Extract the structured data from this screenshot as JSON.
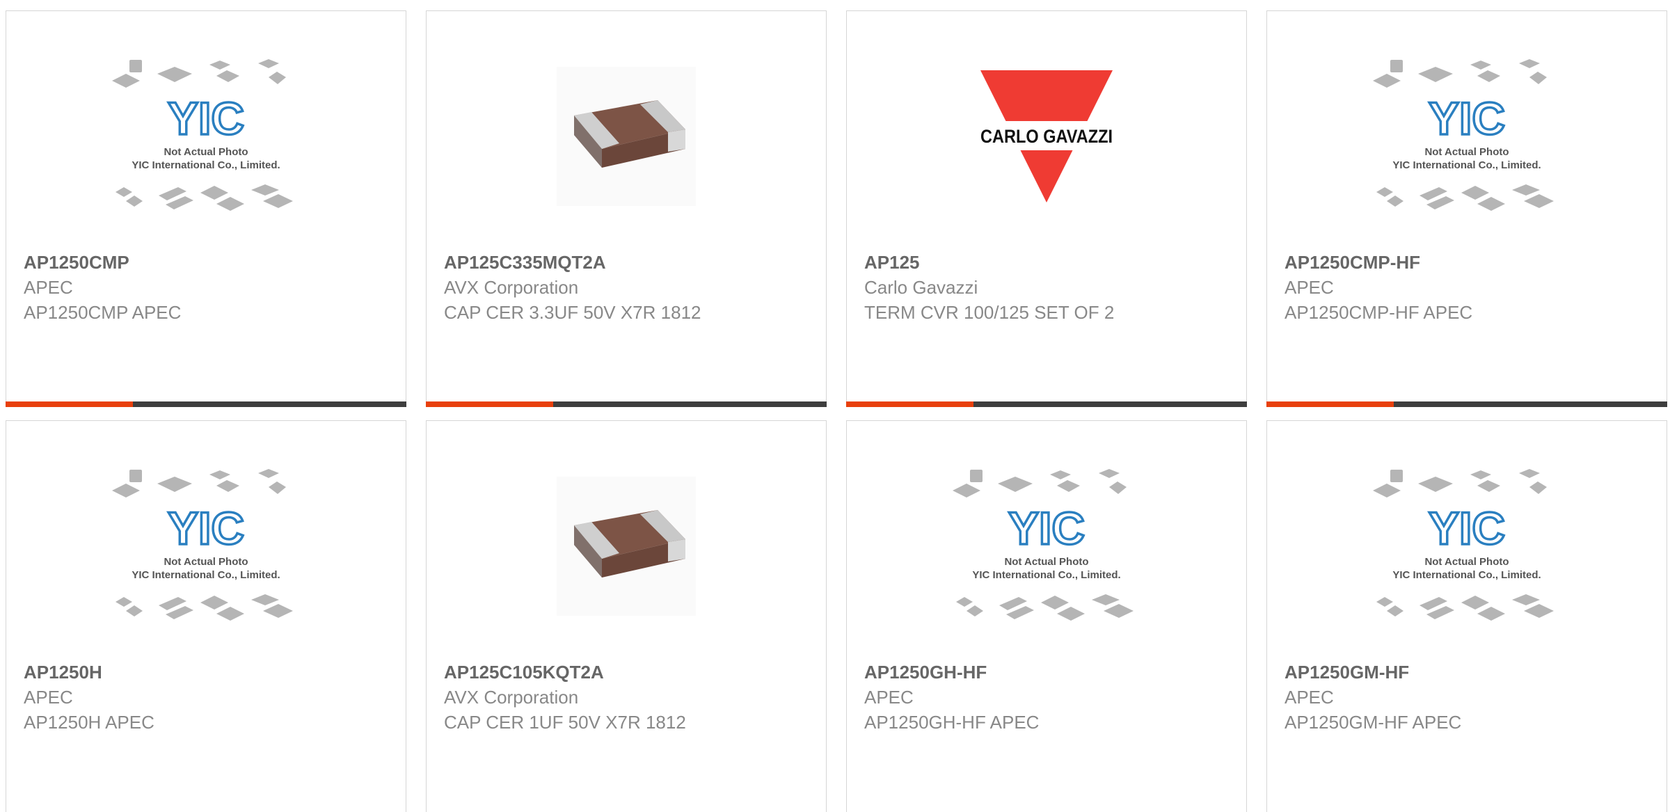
{
  "colors": {
    "accent": "#e8400c",
    "bar_dark": "#3e3e3e",
    "part_text": "#666666",
    "secondary_text": "#888888",
    "yic_blue": "#2a7fc0",
    "gavazzi_red": "#ef3b33"
  },
  "placeholder_image": {
    "line1": "Not Actual Photo",
    "line2": "YIC International Co., Limited.",
    "logo": "YIC"
  },
  "brand_logo": {
    "text": "CARLO GAVAZZI"
  },
  "products": [
    {
      "part": "AP1250CMP",
      "manufacturer": "APEC",
      "description": "AP1250CMP APEC",
      "image": "yic-placeholder-icon"
    },
    {
      "part": "AP125C335MQT2A",
      "manufacturer": "AVX Corporation",
      "description": "CAP CER 3.3UF 50V X7R 1812",
      "image": "ceramic-capacitor-icon"
    },
    {
      "part": "AP125",
      "manufacturer": "Carlo Gavazzi",
      "description": "TERM CVR 100/125 SET OF 2",
      "image": "carlo-gavazzi-logo-icon"
    },
    {
      "part": "AP1250CMP-HF",
      "manufacturer": "APEC",
      "description": "AP1250CMP-HF APEC",
      "image": "yic-placeholder-icon"
    },
    {
      "part": "AP1250H",
      "manufacturer": "APEC",
      "description": "AP1250H APEC",
      "image": "yic-placeholder-icon"
    },
    {
      "part": "AP125C105KQT2A",
      "manufacturer": "AVX Corporation",
      "description": "CAP CER 1UF 50V X7R 1812",
      "image": "ceramic-capacitor-icon"
    },
    {
      "part": "AP1250GH-HF",
      "manufacturer": "APEC",
      "description": "AP1250GH-HF APEC",
      "image": "yic-placeholder-icon"
    },
    {
      "part": "AP1250GM-HF",
      "manufacturer": "APEC",
      "description": "AP1250GM-HF APEC",
      "image": "yic-placeholder-icon"
    }
  ]
}
